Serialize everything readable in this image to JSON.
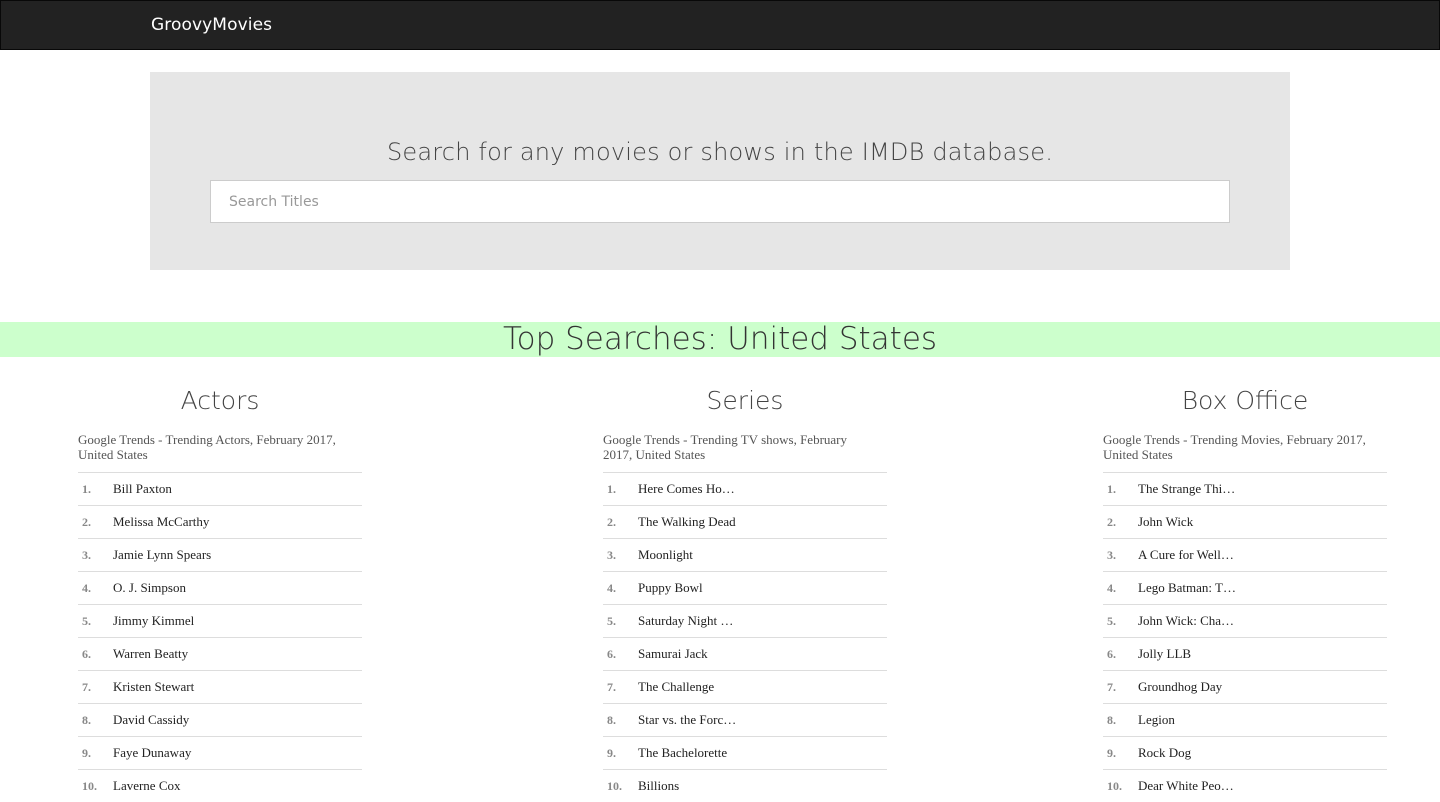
{
  "navbar": {
    "brand": "GroovyMovies"
  },
  "hero": {
    "title": "Search for any movies or shows in the IMDB database.",
    "search_placeholder": "Search Titles",
    "search_value": ""
  },
  "banner": {
    "title": "Top Searches: United States"
  },
  "columns": [
    {
      "heading": "Actors",
      "caption": "Google Trends - Trending Actors, February 2017, United States",
      "items": [
        {
          "rank": "1.",
          "name": "Bill Paxton"
        },
        {
          "rank": "2.",
          "name": "Melissa McCarthy"
        },
        {
          "rank": "3.",
          "name": "Jamie Lynn Spears"
        },
        {
          "rank": "4.",
          "name": "O. J. Simpson"
        },
        {
          "rank": "5.",
          "name": "Jimmy Kimmel"
        },
        {
          "rank": "6.",
          "name": "Warren Beatty"
        },
        {
          "rank": "7.",
          "name": "Kristen Stewart"
        },
        {
          "rank": "8.",
          "name": "David Cassidy"
        },
        {
          "rank": "9.",
          "name": "Faye Dunaway"
        },
        {
          "rank": "10.",
          "name": "Laverne Cox"
        }
      ]
    },
    {
      "heading": "Series",
      "caption": "Google Trends - Trending TV shows, February 2017, United States",
      "items": [
        {
          "rank": "1.",
          "name": "Here Comes Ho…"
        },
        {
          "rank": "2.",
          "name": "The Walking Dead"
        },
        {
          "rank": "3.",
          "name": "Moonlight"
        },
        {
          "rank": "4.",
          "name": "Puppy Bowl"
        },
        {
          "rank": "5.",
          "name": "Saturday Night …"
        },
        {
          "rank": "6.",
          "name": "Samurai Jack"
        },
        {
          "rank": "7.",
          "name": "The Challenge"
        },
        {
          "rank": "8.",
          "name": "Star vs. the Forc…"
        },
        {
          "rank": "9.",
          "name": "The Bachelorette"
        },
        {
          "rank": "10.",
          "name": "Billions"
        }
      ]
    },
    {
      "heading": "Box Office",
      "caption": "Google Trends - Trending Movies, February 2017, United States",
      "items": [
        {
          "rank": "1.",
          "name": "The Strange Thi…"
        },
        {
          "rank": "2.",
          "name": "John Wick"
        },
        {
          "rank": "3.",
          "name": "A Cure for Well…"
        },
        {
          "rank": "4.",
          "name": "Lego Batman: T…"
        },
        {
          "rank": "5.",
          "name": "John Wick: Cha…"
        },
        {
          "rank": "6.",
          "name": "Jolly LLB"
        },
        {
          "rank": "7.",
          "name": "Groundhog Day"
        },
        {
          "rank": "8.",
          "name": "Legion"
        },
        {
          "rank": "9.",
          "name": "Rock Dog"
        },
        {
          "rank": "10.",
          "name": "Dear White Peo…"
        }
      ]
    }
  ]
}
